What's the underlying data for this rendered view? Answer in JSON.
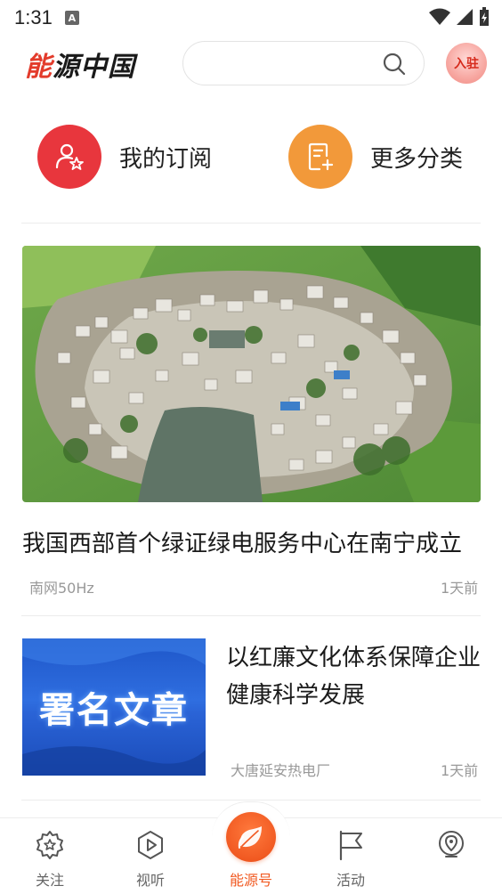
{
  "status_bar": {
    "time": "1:31",
    "notification_letter": "A"
  },
  "header": {
    "logo_text_accent": "能",
    "logo_text_rest": "源中国",
    "search_placeholder": "",
    "join_label": "入驻"
  },
  "quick_entries": [
    {
      "label": "我的订阅",
      "icon": "user-star-icon",
      "color": "#e8363d"
    },
    {
      "label": "更多分类",
      "icon": "document-add-icon",
      "color": "#f2993a"
    }
  ],
  "news": [
    {
      "title": "我国西部首个绿证绿电服务中心在南宁成立",
      "source": "南网50Hz",
      "time": "1天前",
      "image": "aerial-village-photo"
    },
    {
      "title": "以红廉文化体系保障企业健康科学发展",
      "source": "大唐延安热电厂",
      "time": "1天前",
      "thumb_text": "署名文章"
    }
  ],
  "bottom_nav": [
    {
      "label": "关注",
      "icon": "star-badge-icon"
    },
    {
      "label": "视听",
      "icon": "play-icon"
    },
    {
      "label": "能源号",
      "icon": "leaf-icon",
      "active": true
    },
    {
      "label": "活动",
      "icon": "flag-icon"
    },
    {
      "label": "",
      "icon": "location-pin-icon"
    }
  ],
  "colors": {
    "accent_red": "#e8363d",
    "accent_orange": "#f2993a",
    "nav_active": "#f15a22"
  }
}
